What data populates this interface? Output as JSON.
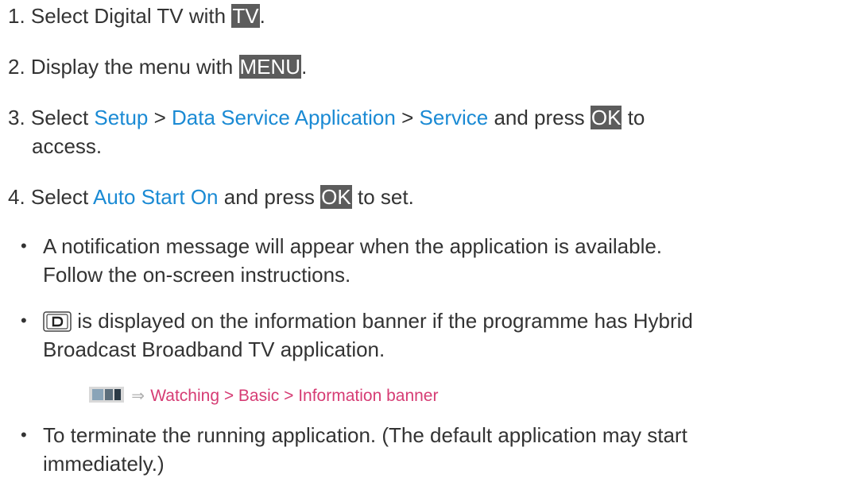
{
  "steps": [
    {
      "num": "1.",
      "text_a": "Select Digital TV with",
      "key": "TV",
      "text_b": "."
    },
    {
      "num": "2.",
      "text_a": "Display the menu with",
      "key": "MENU",
      "text_b": "."
    },
    {
      "num": "3.",
      "text_a": "Select",
      "link_1": "Setup",
      "sep_1": ">",
      "link_2": "Data Service Application",
      "sep_2": ">",
      "link_3": "Service",
      "text_b": "and press",
      "key": "OK",
      "text_c": "to",
      "cont": "access."
    },
    {
      "num": "4.",
      "text_a": "Select",
      "link": "Auto Start On",
      "text_b": "and press",
      "key": "OK",
      "text_c": "to set."
    }
  ],
  "bullets": [
    {
      "line1": "A notification message will appear when the application is available.",
      "line2": "Follow the on-screen instructions."
    },
    {
      "line1_b": "is displayed on the information banner if the programme has Hybrid",
      "line2": "Broadcast Broadband TV application."
    },
    {
      "line1": "To terminate the running application. (The default application may start",
      "line2": "immediately.)"
    }
  ],
  "bullet_char": "•",
  "reference": {
    "arrow": "⇒",
    "text": "Watching > Basic > Information banner"
  },
  "icons": {
    "d_icon": "d-banner-icon",
    "app_icon": "apps-icon"
  },
  "colors": {
    "text": "#333333",
    "link": "#1a8ad4",
    "key_bg": "#5c5c5c",
    "reference": "#d63c74"
  }
}
